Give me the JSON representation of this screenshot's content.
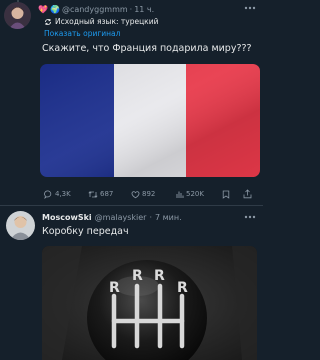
{
  "colors": {
    "background": "#15202b",
    "text": "#e7e9ea",
    "muted": "#8b98a5",
    "accent": "#1d9bf0",
    "flag_blue": "#1c2f8f",
    "flag_white": "#e8e8ec",
    "flag_red": "#e8394a"
  },
  "tweet1": {
    "author_emoji": "💖",
    "author_badge_emoji": "🌍",
    "handle": "@candyggmmm",
    "separator": "·",
    "time": "11 ч.",
    "source_language": "Исходный язык: турецкий",
    "show_original": "Показать оригинал",
    "text": "Скажите, что Франция подарила миру???",
    "image_icon": "france-flag",
    "stats": {
      "replies": "4,3K",
      "retweets": "687",
      "likes": "892",
      "views": "520K"
    }
  },
  "tweet2": {
    "name": "MoscowSki",
    "handle": "@malayskier",
    "separator": "·",
    "time": "7 мин.",
    "text": "Коробку передач",
    "image_icon": "gear-shift-knob",
    "knob_letters": [
      "R",
      "R",
      "R",
      "R"
    ]
  }
}
